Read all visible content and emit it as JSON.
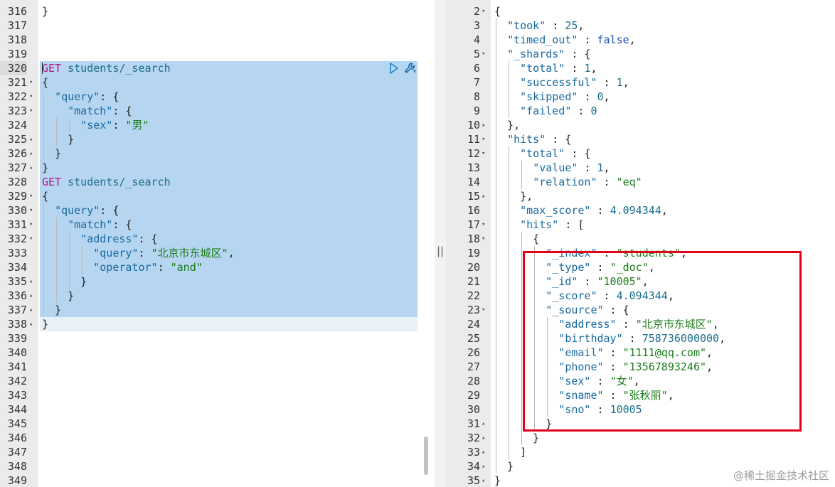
{
  "editor": {
    "lines": [
      {
        "n": "316",
        "fold": "",
        "code": [
          [
            "p",
            "}"
          ]
        ]
      },
      {
        "n": "317",
        "fold": "",
        "code": []
      },
      {
        "n": "318",
        "fold": "",
        "code": []
      },
      {
        "n": "319",
        "fold": "",
        "code": []
      },
      {
        "n": "320",
        "fold": "",
        "active": true,
        "code": [
          [
            "kw",
            "GET"
          ],
          [
            "p",
            " "
          ],
          [
            "pth",
            "students/_search"
          ]
        ]
      },
      {
        "n": "321",
        "fold": "▾",
        "code": [
          [
            "p",
            "{"
          ]
        ]
      },
      {
        "n": "322",
        "fold": "▾",
        "code": [
          [
            "p",
            "  "
          ],
          [
            "key",
            "\"query\""
          ],
          [
            "p",
            ": {"
          ]
        ]
      },
      {
        "n": "323",
        "fold": "▾",
        "code": [
          [
            "p",
            "    "
          ],
          [
            "key",
            "\"match\""
          ],
          [
            "p",
            ": {"
          ]
        ]
      },
      {
        "n": "324",
        "fold": "",
        "code": [
          [
            "p",
            "      "
          ],
          [
            "key",
            "\"sex\""
          ],
          [
            "p",
            ": "
          ],
          [
            "str",
            "\"男\""
          ]
        ]
      },
      {
        "n": "325",
        "fold": "▴",
        "code": [
          [
            "p",
            "    }"
          ]
        ]
      },
      {
        "n": "326",
        "fold": "▴",
        "code": [
          [
            "p",
            "  }"
          ]
        ]
      },
      {
        "n": "327",
        "fold": "▴",
        "code": [
          [
            "p",
            "}"
          ]
        ]
      },
      {
        "n": "328",
        "fold": "",
        "code": [
          [
            "kw",
            "GET"
          ],
          [
            "p",
            " "
          ],
          [
            "pth",
            "students/_search"
          ]
        ]
      },
      {
        "n": "329",
        "fold": "▾",
        "code": [
          [
            "p",
            "{"
          ]
        ]
      },
      {
        "n": "330",
        "fold": "▾",
        "code": [
          [
            "p",
            "  "
          ],
          [
            "key",
            "\"query\""
          ],
          [
            "p",
            ": {"
          ]
        ]
      },
      {
        "n": "331",
        "fold": "▾",
        "code": [
          [
            "p",
            "    "
          ],
          [
            "key",
            "\"match\""
          ],
          [
            "p",
            ": {"
          ]
        ]
      },
      {
        "n": "332",
        "fold": "▾",
        "code": [
          [
            "p",
            "      "
          ],
          [
            "key",
            "\"address\""
          ],
          [
            "p",
            ": {"
          ]
        ]
      },
      {
        "n": "333",
        "fold": "",
        "code": [
          [
            "p",
            "        "
          ],
          [
            "key",
            "\"query\""
          ],
          [
            "p",
            ": "
          ],
          [
            "str",
            "\"北京市东城区\""
          ],
          [
            "p",
            ","
          ]
        ]
      },
      {
        "n": "334",
        "fold": "",
        "code": [
          [
            "p",
            "        "
          ],
          [
            "key",
            "\"operator\""
          ],
          [
            "p",
            ": "
          ],
          [
            "str",
            "\"and\""
          ]
        ]
      },
      {
        "n": "335",
        "fold": "▴",
        "code": [
          [
            "p",
            "      }"
          ]
        ]
      },
      {
        "n": "336",
        "fold": "▴",
        "code": [
          [
            "p",
            "    }"
          ]
        ]
      },
      {
        "n": "337",
        "fold": "▴",
        "code": [
          [
            "p",
            "  }"
          ]
        ]
      },
      {
        "n": "338",
        "fold": "▴",
        "code": [
          [
            "p",
            "}"
          ]
        ]
      },
      {
        "n": "339",
        "fold": "",
        "code": []
      },
      {
        "n": "340",
        "fold": "",
        "code": []
      },
      {
        "n": "341",
        "fold": "",
        "code": []
      },
      {
        "n": "342",
        "fold": "",
        "code": []
      },
      {
        "n": "343",
        "fold": "",
        "code": []
      },
      {
        "n": "344",
        "fold": "",
        "code": []
      },
      {
        "n": "345",
        "fold": "",
        "code": []
      },
      {
        "n": "346",
        "fold": "",
        "code": []
      },
      {
        "n": "347",
        "fold": "",
        "code": []
      },
      {
        "n": "348",
        "fold": "",
        "code": []
      },
      {
        "n": "349",
        "fold": "",
        "code": []
      }
    ]
  },
  "output": {
    "lines": [
      {
        "n": "2",
        "fold": "▾",
        "code": [
          [
            "p",
            "{"
          ]
        ]
      },
      {
        "n": "3",
        "fold": "",
        "code": [
          [
            "p",
            "  "
          ],
          [
            "key",
            "\"took\""
          ],
          [
            "p",
            " : "
          ],
          [
            "num",
            "25"
          ],
          [
            "p",
            ","
          ]
        ]
      },
      {
        "n": "4",
        "fold": "",
        "code": [
          [
            "p",
            "  "
          ],
          [
            "key",
            "\"timed_out\""
          ],
          [
            "p",
            " : "
          ],
          [
            "bool",
            "false"
          ],
          [
            "p",
            ","
          ]
        ]
      },
      {
        "n": "5",
        "fold": "▾",
        "code": [
          [
            "p",
            "  "
          ],
          [
            "key",
            "\"_shards\""
          ],
          [
            "p",
            " : {"
          ]
        ]
      },
      {
        "n": "6",
        "fold": "",
        "code": [
          [
            "p",
            "    "
          ],
          [
            "key",
            "\"total\""
          ],
          [
            "p",
            " : "
          ],
          [
            "num",
            "1"
          ],
          [
            "p",
            ","
          ]
        ]
      },
      {
        "n": "7",
        "fold": "",
        "code": [
          [
            "p",
            "    "
          ],
          [
            "key",
            "\"successful\""
          ],
          [
            "p",
            " : "
          ],
          [
            "num",
            "1"
          ],
          [
            "p",
            ","
          ]
        ]
      },
      {
        "n": "8",
        "fold": "",
        "code": [
          [
            "p",
            "    "
          ],
          [
            "key",
            "\"skipped\""
          ],
          [
            "p",
            " : "
          ],
          [
            "num",
            "0"
          ],
          [
            "p",
            ","
          ]
        ]
      },
      {
        "n": "9",
        "fold": "",
        "code": [
          [
            "p",
            "    "
          ],
          [
            "key",
            "\"failed\""
          ],
          [
            "p",
            " : "
          ],
          [
            "num",
            "0"
          ]
        ]
      },
      {
        "n": "10",
        "fold": "▴",
        "code": [
          [
            "p",
            "  },"
          ]
        ]
      },
      {
        "n": "11",
        "fold": "▾",
        "code": [
          [
            "p",
            "  "
          ],
          [
            "key",
            "\"hits\""
          ],
          [
            "p",
            " : {"
          ]
        ]
      },
      {
        "n": "12",
        "fold": "▾",
        "code": [
          [
            "p",
            "    "
          ],
          [
            "key",
            "\"total\""
          ],
          [
            "p",
            " : {"
          ]
        ]
      },
      {
        "n": "13",
        "fold": "",
        "code": [
          [
            "p",
            "      "
          ],
          [
            "key",
            "\"value\""
          ],
          [
            "p",
            " : "
          ],
          [
            "num",
            "1"
          ],
          [
            "p",
            ","
          ]
        ]
      },
      {
        "n": "14",
        "fold": "",
        "code": [
          [
            "p",
            "      "
          ],
          [
            "key",
            "\"relation\""
          ],
          [
            "p",
            " : "
          ],
          [
            "str",
            "\"eq\""
          ]
        ]
      },
      {
        "n": "15",
        "fold": "▴",
        "code": [
          [
            "p",
            "    },"
          ]
        ]
      },
      {
        "n": "16",
        "fold": "",
        "code": [
          [
            "p",
            "    "
          ],
          [
            "key",
            "\"max_score\""
          ],
          [
            "p",
            " : "
          ],
          [
            "num",
            "4.094344"
          ],
          [
            "p",
            ","
          ]
        ]
      },
      {
        "n": "17",
        "fold": "▾",
        "code": [
          [
            "p",
            "    "
          ],
          [
            "key",
            "\"hits\""
          ],
          [
            "p",
            " : ["
          ]
        ]
      },
      {
        "n": "18",
        "fold": "▾",
        "code": [
          [
            "p",
            "      {"
          ]
        ]
      },
      {
        "n": "19",
        "fold": "",
        "code": [
          [
            "p",
            "        "
          ],
          [
            "key",
            "\"_index\""
          ],
          [
            "p",
            " : "
          ],
          [
            "str",
            "\"students\""
          ],
          [
            "p",
            ","
          ]
        ]
      },
      {
        "n": "20",
        "fold": "",
        "code": [
          [
            "p",
            "        "
          ],
          [
            "key",
            "\"_type\""
          ],
          [
            "p",
            " : "
          ],
          [
            "str",
            "\"_doc\""
          ],
          [
            "p",
            ","
          ]
        ]
      },
      {
        "n": "21",
        "fold": "",
        "code": [
          [
            "p",
            "        "
          ],
          [
            "key",
            "\"_id\""
          ],
          [
            "p",
            " : "
          ],
          [
            "str",
            "\"10005\""
          ],
          [
            "p",
            ","
          ]
        ]
      },
      {
        "n": "22",
        "fold": "",
        "code": [
          [
            "p",
            "        "
          ],
          [
            "key",
            "\"_score\""
          ],
          [
            "p",
            " : "
          ],
          [
            "num",
            "4.094344"
          ],
          [
            "p",
            ","
          ]
        ]
      },
      {
        "n": "23",
        "fold": "▾",
        "code": [
          [
            "p",
            "        "
          ],
          [
            "key",
            "\"_source\""
          ],
          [
            "p",
            " : {"
          ]
        ]
      },
      {
        "n": "24",
        "fold": "",
        "code": [
          [
            "p",
            "          "
          ],
          [
            "key",
            "\"address\""
          ],
          [
            "p",
            " : "
          ],
          [
            "str",
            "\"北京市东城区\""
          ],
          [
            "p",
            ","
          ]
        ]
      },
      {
        "n": "25",
        "fold": "",
        "code": [
          [
            "p",
            "          "
          ],
          [
            "key",
            "\"birthday\""
          ],
          [
            "p",
            " : "
          ],
          [
            "num",
            "758736000000"
          ],
          [
            "p",
            ","
          ]
        ]
      },
      {
        "n": "26",
        "fold": "",
        "code": [
          [
            "p",
            "          "
          ],
          [
            "key",
            "\"email\""
          ],
          [
            "p",
            " : "
          ],
          [
            "str",
            "\"1111@qq.com\""
          ],
          [
            "p",
            ","
          ]
        ]
      },
      {
        "n": "27",
        "fold": "",
        "code": [
          [
            "p",
            "          "
          ],
          [
            "key",
            "\"phone\""
          ],
          [
            "p",
            " : "
          ],
          [
            "str",
            "\"13567893246\""
          ],
          [
            "p",
            ","
          ]
        ]
      },
      {
        "n": "28",
        "fold": "",
        "code": [
          [
            "p",
            "          "
          ],
          [
            "key",
            "\"sex\""
          ],
          [
            "p",
            " : "
          ],
          [
            "str",
            "\"女\""
          ],
          [
            "p",
            ","
          ]
        ]
      },
      {
        "n": "29",
        "fold": "",
        "code": [
          [
            "p",
            "          "
          ],
          [
            "key",
            "\"sname\""
          ],
          [
            "p",
            " : "
          ],
          [
            "str",
            "\"张秋丽\""
          ],
          [
            "p",
            ","
          ]
        ]
      },
      {
        "n": "30",
        "fold": "",
        "code": [
          [
            "p",
            "          "
          ],
          [
            "key",
            "\"sno\""
          ],
          [
            "p",
            " : "
          ],
          [
            "num",
            "10005"
          ]
        ]
      },
      {
        "n": "31",
        "fold": "▴",
        "code": [
          [
            "p",
            "        }"
          ]
        ]
      },
      {
        "n": "32",
        "fold": "▴",
        "code": [
          [
            "p",
            "      }"
          ]
        ]
      },
      {
        "n": "33",
        "fold": "▴",
        "code": [
          [
            "p",
            "    ]"
          ]
        ]
      },
      {
        "n": "34",
        "fold": "▴",
        "code": [
          [
            "p",
            "  }"
          ]
        ]
      },
      {
        "n": "35",
        "fold": "▴",
        "code": [
          [
            "p",
            "}"
          ]
        ]
      }
    ]
  },
  "icons": {
    "run": "play-triangle",
    "settings": "wrench",
    "divider": "||"
  },
  "colors": {
    "selection": "#b5d5f0",
    "keyword": "#b5168a",
    "key": "#186aa0",
    "string": "#1b7d1b",
    "number": "#1a6e8c",
    "highlight_box": "#e3001b"
  },
  "watermark": "@稀土掘金技术社区"
}
